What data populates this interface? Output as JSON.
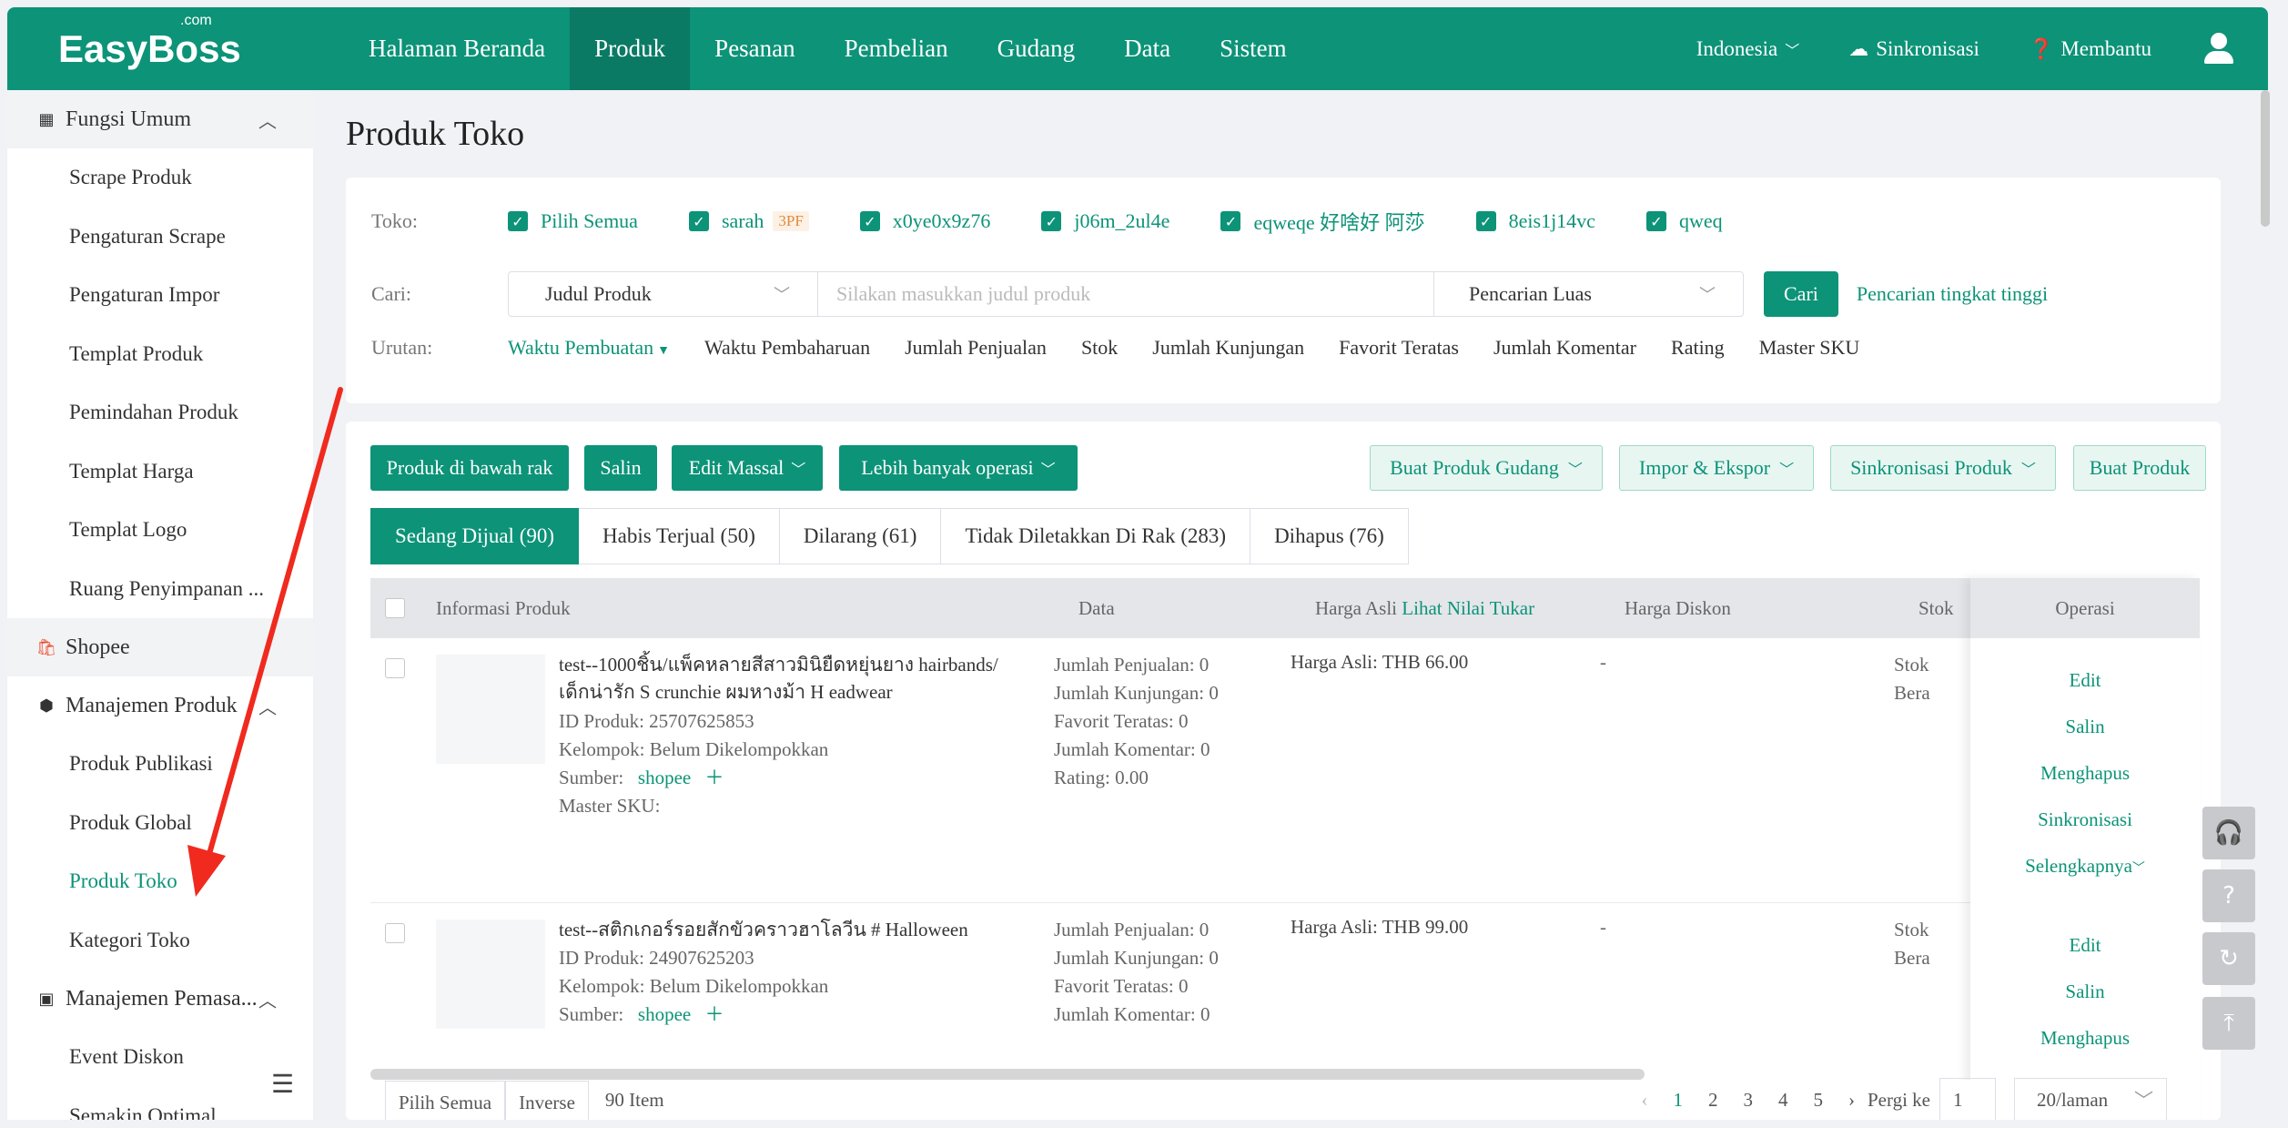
{
  "app": {
    "logo": "EasyBoss",
    "logo_sup": ".com",
    "nav": [
      "Halaman Beranda",
      "Produk",
      "Pesanan",
      "Pembelian",
      "Gudang",
      "Data",
      "Sistem"
    ],
    "nav_active": "Produk",
    "region": "Indonesia",
    "sync": "Sinkronisasi",
    "help": "Membantu"
  },
  "sidebar": {
    "group_fungsi": "Fungsi Umum",
    "fungsi_items": [
      "Scrape Produk",
      "Pengaturan Scrape",
      "Pengaturan Impor",
      "Templat Produk",
      "Pemindahan Produk",
      "Templat Harga",
      "Templat Logo",
      "Ruang Penyimpanan ..."
    ],
    "shopee": "Shopee",
    "group_manajemen": "Manajemen Produk",
    "manajemen_items": [
      "Produk Publikasi",
      "Produk Global",
      "Produk Toko",
      "Kategori Toko"
    ],
    "active_item": "Produk Toko",
    "group_pemasaran": "Manajemen Pemasa...",
    "pemasaran_items": [
      "Event Diskon",
      "Semakin Optimal..."
    ]
  },
  "page": {
    "title": "Produk Toko"
  },
  "filter": {
    "toko_label": "Toko:",
    "stores": [
      "Pilih Semua",
      "sarah",
      "x0ye0x9z76",
      "j06m_2ul4e",
      "eqweqe 好啥好 阿莎",
      "8eis1j14vc",
      "qweq"
    ],
    "store_tag": "3PF",
    "cari_label": "Cari:",
    "search_field": "Judul Produk",
    "search_placeholder": "Silakan masukkan judul produk",
    "search_mode": "Pencarian Luas",
    "search_button": "Cari",
    "advanced_link": "Pencarian tingkat tinggi",
    "urutan_label": "Urutan:",
    "sort_options": [
      "Waktu Pembuatan",
      "Waktu Pembaharuan",
      "Jumlah Penjualan",
      "Stok",
      "Jumlah Kunjungan",
      "Favorit Teratas",
      "Jumlah Komentar",
      "Rating",
      "Master SKU"
    ]
  },
  "actions": {
    "produk_bawah_rak": "Produk di bawah rak",
    "salin": "Salin",
    "edit_massal": "Edit Massal",
    "lebih_banyak": "Lebih banyak operasi",
    "buat_produk_gudang": "Buat Produk Gudang",
    "impor_ekspor": "Impor & Ekspor",
    "sinkronisasi_produk": "Sinkronisasi Produk",
    "buat_produk": "Buat Produk"
  },
  "tabs": [
    {
      "label": "Sedang Dijual (90)"
    },
    {
      "label": "Habis Terjual (50)"
    },
    {
      "label": "Dilarang (61)"
    },
    {
      "label": "Tidak Diletakkan Di Rak (283)"
    },
    {
      "label": "Dihapus (76)"
    }
  ],
  "table": {
    "headers": {
      "info": "Informasi Produk",
      "data": "Data",
      "harga_asli": "Harga Asli",
      "lihat_nilai_tukar": "Lihat Nilai Tukar",
      "harga_diskon": "Harga Diskon",
      "stok": "Stok",
      "operasi": "Operasi"
    },
    "rows": [
      {
        "title_line1": "test--1000ชิ้น/แพ็คหลายสีสาวมินิยืดหยุ่นยาง hairbands/",
        "title_line2": "เด็กน่ารัก S crunchie ผมหางม้า H eadwear",
        "id": "ID Produk:  25707625853",
        "kelompok": "Kelompok:   Belum Dikelompokkan",
        "sumber_label": "Sumber:",
        "sumber": "shopee",
        "master_sku": "Master SKU:",
        "penjualan": "Jumlah Penjualan:  0",
        "kunjungan": "Jumlah Kunjungan:  0",
        "favorit": "Favorit Teratas:  0",
        "komentar": "Jumlah Komentar:  0",
        "rating": "Rating:  0.00",
        "harga": "Harga Asli:  THB 66.00",
        "diskon": "-",
        "stok1": "Stok",
        "stok2": "Bera",
        "ops": [
          "Edit",
          "Salin",
          "Menghapus",
          "Sinkronisasi",
          "Selengkapnya"
        ]
      },
      {
        "title_line1": "test--สติกเกอร์รอยสักขัวคราวฮาโลวีน # Halloween",
        "id": "ID Produk:  24907625203",
        "kelompok": "Kelompok:   Belum Dikelompokkan",
        "sumber_label": "Sumber:",
        "sumber": "shopee",
        "penjualan": "Jumlah Penjualan:  0",
        "kunjungan": "Jumlah Kunjungan:  0",
        "favorit": "Favorit Teratas:  0",
        "komentar": "Jumlah Komentar:  0",
        "harga": "Harga Asli:  THB 99.00",
        "diskon": "-",
        "stok1": "Stok",
        "stok2": "Bera",
        "ops": [
          "Edit",
          "Salin",
          "Menghapus"
        ]
      }
    ]
  },
  "footer": {
    "pilih_semua": "Pilih Semua",
    "inverse": "Inverse",
    "count": "90 Item",
    "pages": [
      "1",
      "2",
      "3",
      "4",
      "5"
    ],
    "goto_label": "Pergi ke",
    "goto_value": "1",
    "per_page": "20/laman"
  },
  "colors": {
    "brand": "#0c9378",
    "annotation_arrow": "#f02a1e"
  }
}
